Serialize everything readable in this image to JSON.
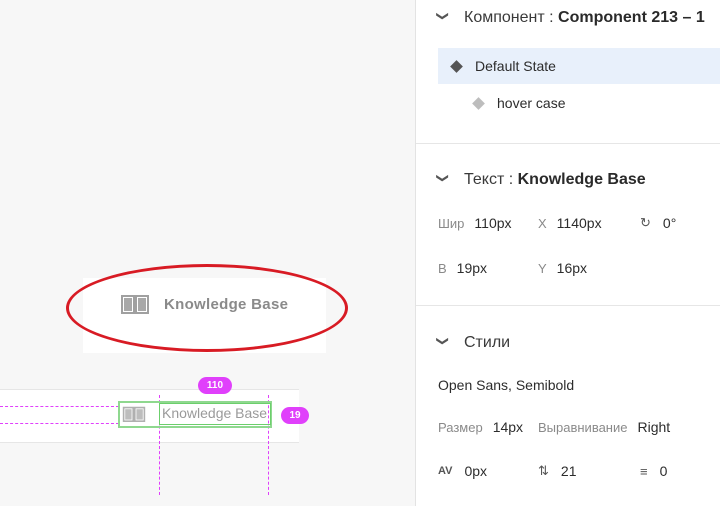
{
  "component_section": {
    "label": "Компонент",
    "value": "Component 213 – 1",
    "states": [
      {
        "label": "Default State"
      },
      {
        "label": "hover case"
      }
    ]
  },
  "text_section": {
    "label": "Текст",
    "value": "Knowledge Base",
    "width_label": "Шир",
    "width_value": "110px",
    "x_label": "X",
    "x_value": "1140px",
    "rotation_value": "0°",
    "height_label": "В",
    "height_value": "19px",
    "y_label": "Y",
    "y_value": "16px"
  },
  "styles_section": {
    "label": "Стили",
    "font": "Open Sans, Semibold",
    "size_label": "Размер",
    "size_value": "14px",
    "align_label": "Выравнивание",
    "align_value": "Right",
    "char_spacing_value": "0px",
    "line_spacing_value": "21",
    "paragraph_spacing_value": "0"
  },
  "canvas": {
    "card_label": "Knowledge Base",
    "nav_label": "Knowledge Base",
    "width_badge": "110",
    "height_badge": "19"
  },
  "colors": {
    "highlight_ellipse": "#d81b24",
    "guide": "#e040fb",
    "selection": "#6ccf6c",
    "active_state_bg": "#e8f0fb"
  }
}
